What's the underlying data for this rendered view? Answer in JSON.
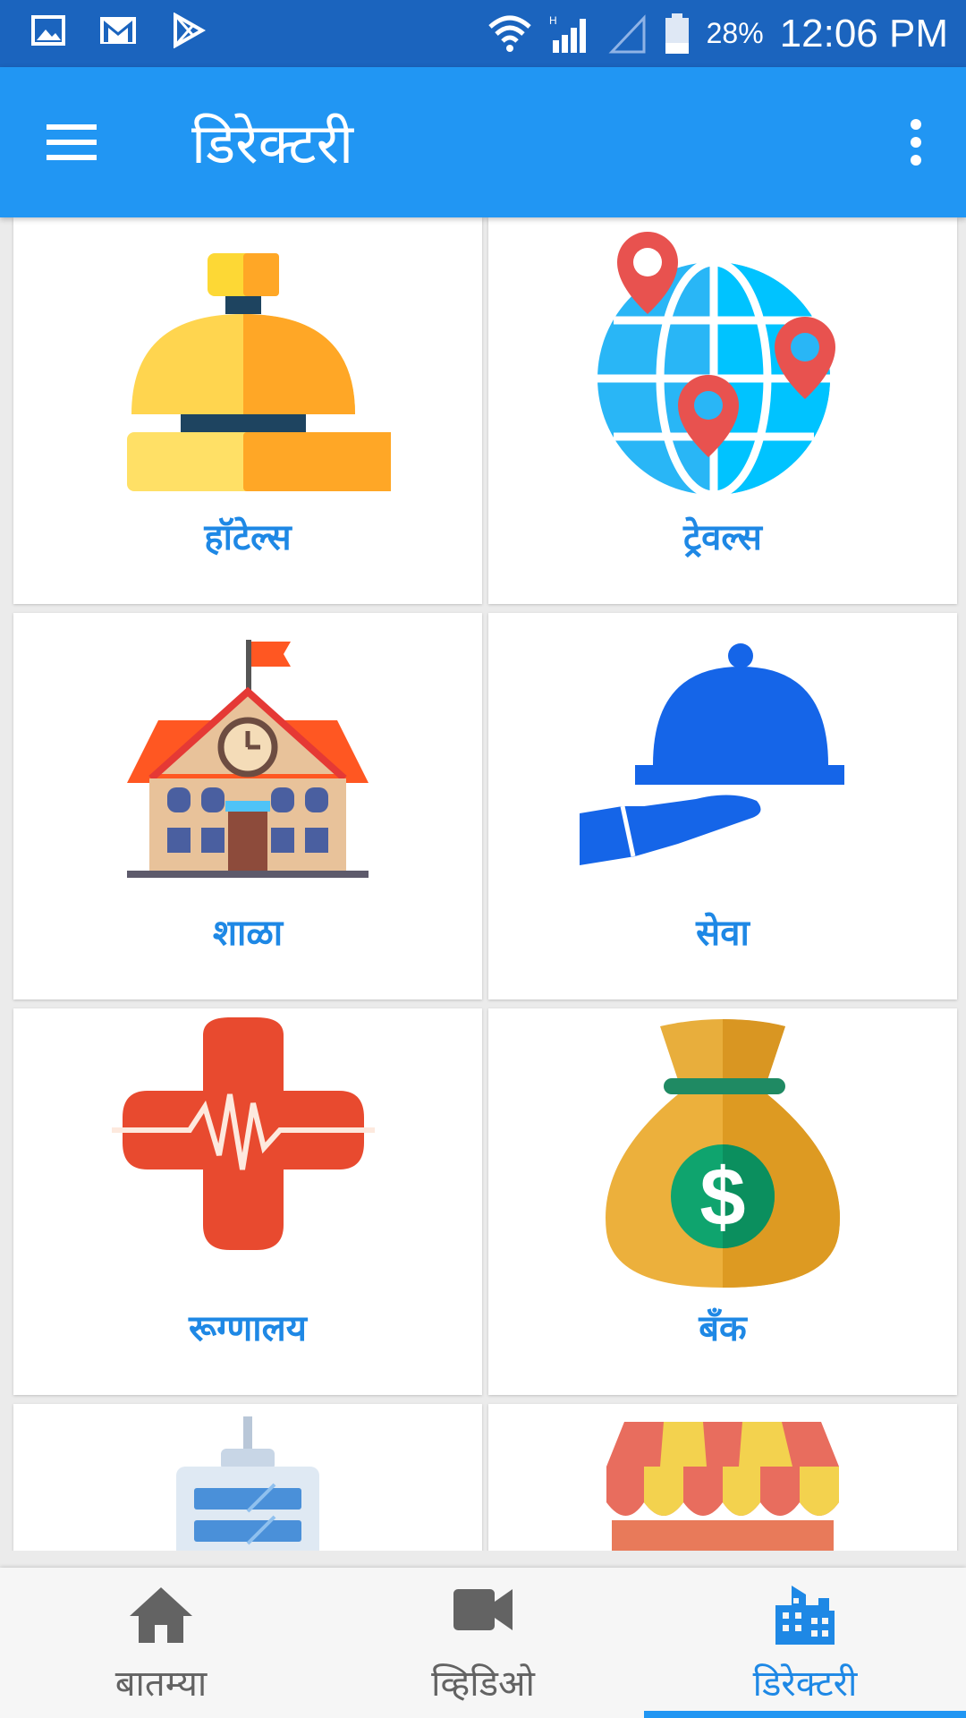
{
  "status_bar": {
    "battery_percent": "28%",
    "time": "12:06 PM"
  },
  "app_bar": {
    "title": "डिरेक्टरी"
  },
  "categories": [
    {
      "label": "हॉटेल्स",
      "icon": "hotel-bell-icon"
    },
    {
      "label": "ट्रेवल्स",
      "icon": "globe-pins-icon"
    },
    {
      "label": "शाळा",
      "icon": "school-building-icon"
    },
    {
      "label": "सेवा",
      "icon": "service-cloche-icon"
    },
    {
      "label": "रूग्णालय",
      "icon": "medical-cross-icon"
    },
    {
      "label": "बँक",
      "icon": "money-bag-icon"
    },
    {
      "label": "",
      "icon": "office-building-icon"
    },
    {
      "label": "",
      "icon": "shop-awning-icon"
    }
  ],
  "bottom_nav": {
    "items": [
      {
        "label": "बातम्या",
        "icon": "home-icon",
        "active": false
      },
      {
        "label": "व्हिडिओ",
        "icon": "video-camera-icon",
        "active": false
      },
      {
        "label": "डिरेक्टरी",
        "icon": "city-buildings-icon",
        "active": true
      }
    ]
  },
  "colors": {
    "status_bar": "#1b64be",
    "app_bar": "#2196f3",
    "label_blue": "#1e88e5",
    "nav_inactive": "#636363"
  }
}
